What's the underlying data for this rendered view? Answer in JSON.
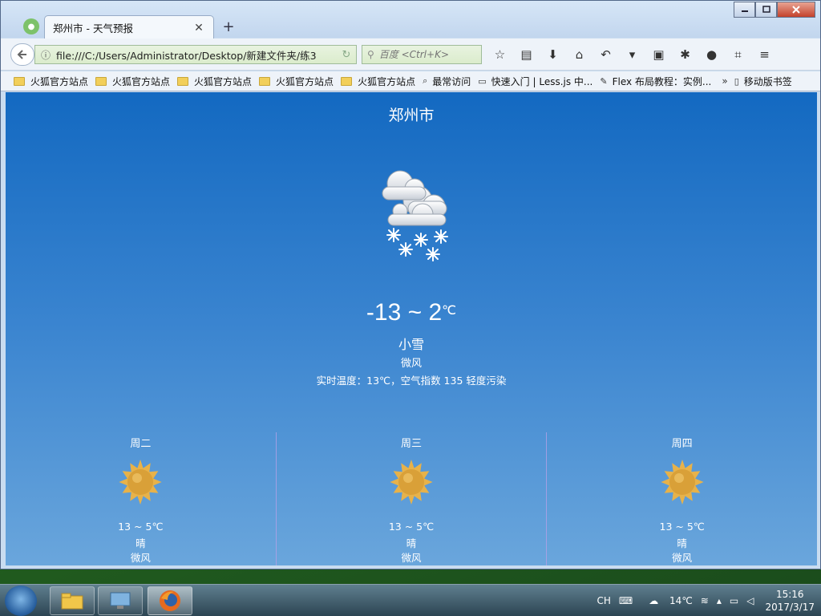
{
  "browser": {
    "tab_title": "郑州市 - 天气预报",
    "tab_close": "✕",
    "new_tab": "+",
    "url": "file:///C:/Users/Administrator/Desktop/新建文件夹/练3",
    "search_placeholder": "百度 <Ctrl+K>",
    "bookmarks": [
      {
        "label": "火狐官方站点",
        "icon": "folder-icon"
      },
      {
        "label": "火狐官方站点",
        "icon": "folder-icon"
      },
      {
        "label": "火狐官方站点",
        "icon": "folder-icon"
      },
      {
        "label": "火狐官方站点",
        "icon": "folder-icon"
      },
      {
        "label": "火狐官方站点",
        "icon": "folder-icon"
      },
      {
        "label": "最常访问",
        "icon": "search-page-icon"
      },
      {
        "label": "快速入门 | Less.js 中...",
        "icon": "less-icon"
      },
      {
        "label": "Flex 布局教程：实例...",
        "icon": "site-icon"
      }
    ],
    "bookmarks_overflow": "»",
    "mobile_bookmarks": "移动版书签"
  },
  "weather": {
    "city": "郑州市",
    "temp_range": "-13 ~ 2",
    "temp_unit": "℃",
    "condition": "小雪",
    "wind": "微风",
    "detail": "实时温度：13℃，空气指数 135 轻度污染",
    "main_icon": "snow-cloud-icon",
    "forecast": [
      {
        "day": "周二",
        "range": "13 ~ 5℃",
        "condition": "晴",
        "wind": "微风",
        "icon": "sun-icon"
      },
      {
        "day": "周三",
        "range": "13 ~ 5℃",
        "condition": "晴",
        "wind": "微风",
        "icon": "sun-icon"
      },
      {
        "day": "周四",
        "range": "13 ~ 5℃",
        "condition": "晴",
        "wind": "微风",
        "icon": "sun-icon"
      }
    ]
  },
  "taskbar": {
    "lang": "CH",
    "weather_temp": "14℃",
    "time": "15:16",
    "date": "2017/3/17"
  },
  "colors": {
    "sky_top": "#1369c1",
    "sky_bottom": "#6aa6dc",
    "sun": "#e3a53a"
  }
}
